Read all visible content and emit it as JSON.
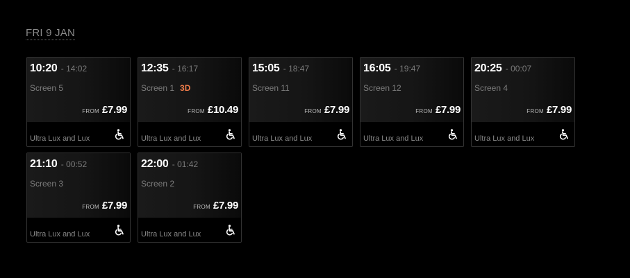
{
  "date_heading": "FRI 9 JAN",
  "from_label": "FROM",
  "showings": [
    {
      "start": "10:20",
      "end": "14:02",
      "screen": "Screen 5",
      "format": "",
      "price": "£7.99",
      "seat_type": "Ultra Lux and Lux",
      "accessible_icon": "wheelchair-icon"
    },
    {
      "start": "12:35",
      "end": "16:17",
      "screen": "Screen 1",
      "format": "3D",
      "price": "£10.49",
      "seat_type": "Ultra Lux and Lux",
      "accessible_icon": "wheelchair-icon"
    },
    {
      "start": "15:05",
      "end": "18:47",
      "screen": "Screen 11",
      "format": "",
      "price": "£7.99",
      "seat_type": "Ultra Lux and Lux",
      "accessible_icon": "wheelchair-icon"
    },
    {
      "start": "16:05",
      "end": "19:47",
      "screen": "Screen 12",
      "format": "",
      "price": "£7.99",
      "seat_type": "Ultra Lux and Lux",
      "accessible_icon": "wheelchair-icon"
    },
    {
      "start": "20:25",
      "end": "00:07",
      "screen": "Screen 4",
      "format": "",
      "price": "£7.99",
      "seat_type": "Ultra Lux and Lux",
      "accessible_icon": "wheelchair-icon"
    },
    {
      "start": "21:10",
      "end": "00:52",
      "screen": "Screen 3",
      "format": "",
      "price": "£7.99",
      "seat_type": "Ultra Lux and Lux",
      "accessible_icon": "wheelchair-icon"
    },
    {
      "start": "22:00",
      "end": "01:42",
      "screen": "Screen 2",
      "format": "",
      "price": "£7.99",
      "seat_type": "Ultra Lux and Lux",
      "accessible_icon": "wheelchair-icon"
    }
  ],
  "colors": {
    "background": "#000000",
    "accent_3d": "#f07c4a",
    "price": "#ffffff",
    "muted_text": "#7d7d7d"
  }
}
